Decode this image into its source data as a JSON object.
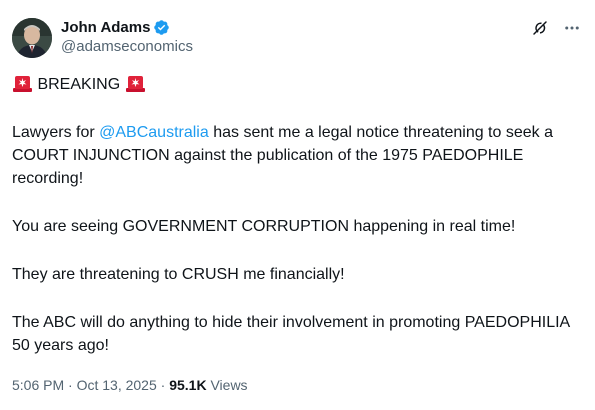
{
  "author": {
    "display_name": "John Adams",
    "handle": "@adamseconomics"
  },
  "icons": {
    "verified": "verified-badge-icon",
    "grok": "grok-icon",
    "more": "more-dots-icon",
    "siren": "siren-emoji-icon"
  },
  "colors": {
    "mention": "#1d9bf0",
    "verified": "#1d9bf0",
    "text": "#0f1419",
    "secondary": "#536471"
  },
  "tweet": {
    "breaking": "BREAKING",
    "p1_before": "Lawyers for ",
    "p1_mention": "@ABCaustralia",
    "p1_after": " has sent me a legal notice threatening to seek a COURT INJUNCTION against the publication of the 1975 PAEDOPHILE recording!",
    "p2": "You are seeing GOVERNMENT CORRUPTION happening in real time!",
    "p3": "They are threatening to CRUSH me financially!",
    "p4": "The ABC will do anything to hide their involvement in promoting PAEDOPHILIA 50 years ago!"
  },
  "meta": {
    "time": "5:06 PM",
    "separator": " · ",
    "date": "Oct 13, 2025",
    "views_count": "95.1K",
    "views_label": " Views"
  }
}
